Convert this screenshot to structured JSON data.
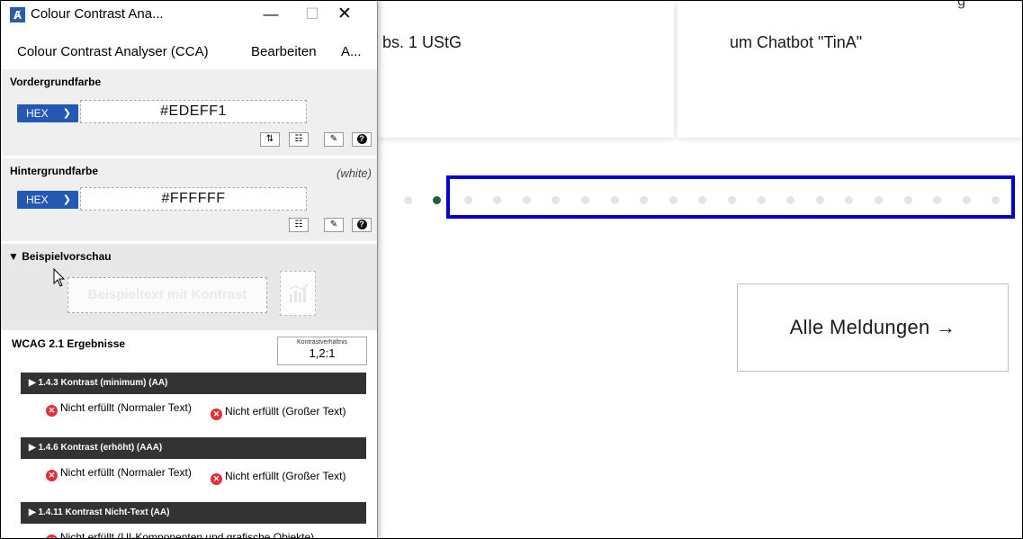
{
  "page": {
    "card_left_text": "bs. 1 UStG",
    "card_right_text": "um Chatbot \"TinA\"",
    "card_right_top": "g",
    "all_news_label": "Alle Meldungen →",
    "carousel": {
      "dot_count": 21,
      "active_index": 1,
      "highlight_color": "#0000CC"
    }
  },
  "cca": {
    "title": "Colour Contrast Ana...",
    "window_controls": {
      "minimize": "—",
      "maximize": "☐",
      "close": "✕"
    },
    "menu": {
      "app": "Colour Contrast Analyser (CCA)",
      "edit": "Bearbeiten",
      "more": "A..."
    },
    "foreground": {
      "label": "Vordergrundfarbe",
      "format": "HEX",
      "value": "#EDEFF1",
      "tools": [
        "swap-icon",
        "sliders-icon",
        "eyedropper-icon",
        "help-icon"
      ]
    },
    "background": {
      "label": "Hintergrundfarbe",
      "name": "(white)",
      "format": "HEX",
      "value": "#FFFFFF",
      "tools": [
        "sliders-icon",
        "eyedropper-icon",
        "help-icon"
      ]
    },
    "preview": {
      "label": "▼ Beispielvorschau",
      "sample_text": "Beispieltext mit Kontrast"
    },
    "results": {
      "title": "WCAG 2.1 Ergebnisse",
      "ratio_label": "Kontrastverhältnis",
      "ratio_value": "1,2:1",
      "criteria": [
        {
          "label": "▶  1.4.3 Kontrast (minimum) (AA)",
          "normal": "Nicht erfüllt (Normaler Text)",
          "large": "Nicht erfüllt (Großer Text)"
        },
        {
          "label": "▶  1.4.6 Kontrast (erhöht) (AAA)",
          "normal": "Nicht erfüllt (Normaler Text)",
          "large": "Nicht erfüllt (Großer Text)"
        },
        {
          "label": "▶  1.4.11 Kontrast Nicht-Text (AA)",
          "ui": "Nicht erfüllt (UI-Komponenten und grafische Objekte)"
        }
      ]
    },
    "colors": {
      "accent": "#2358B4",
      "fail": "#E0303A",
      "bar": "#333333"
    }
  }
}
